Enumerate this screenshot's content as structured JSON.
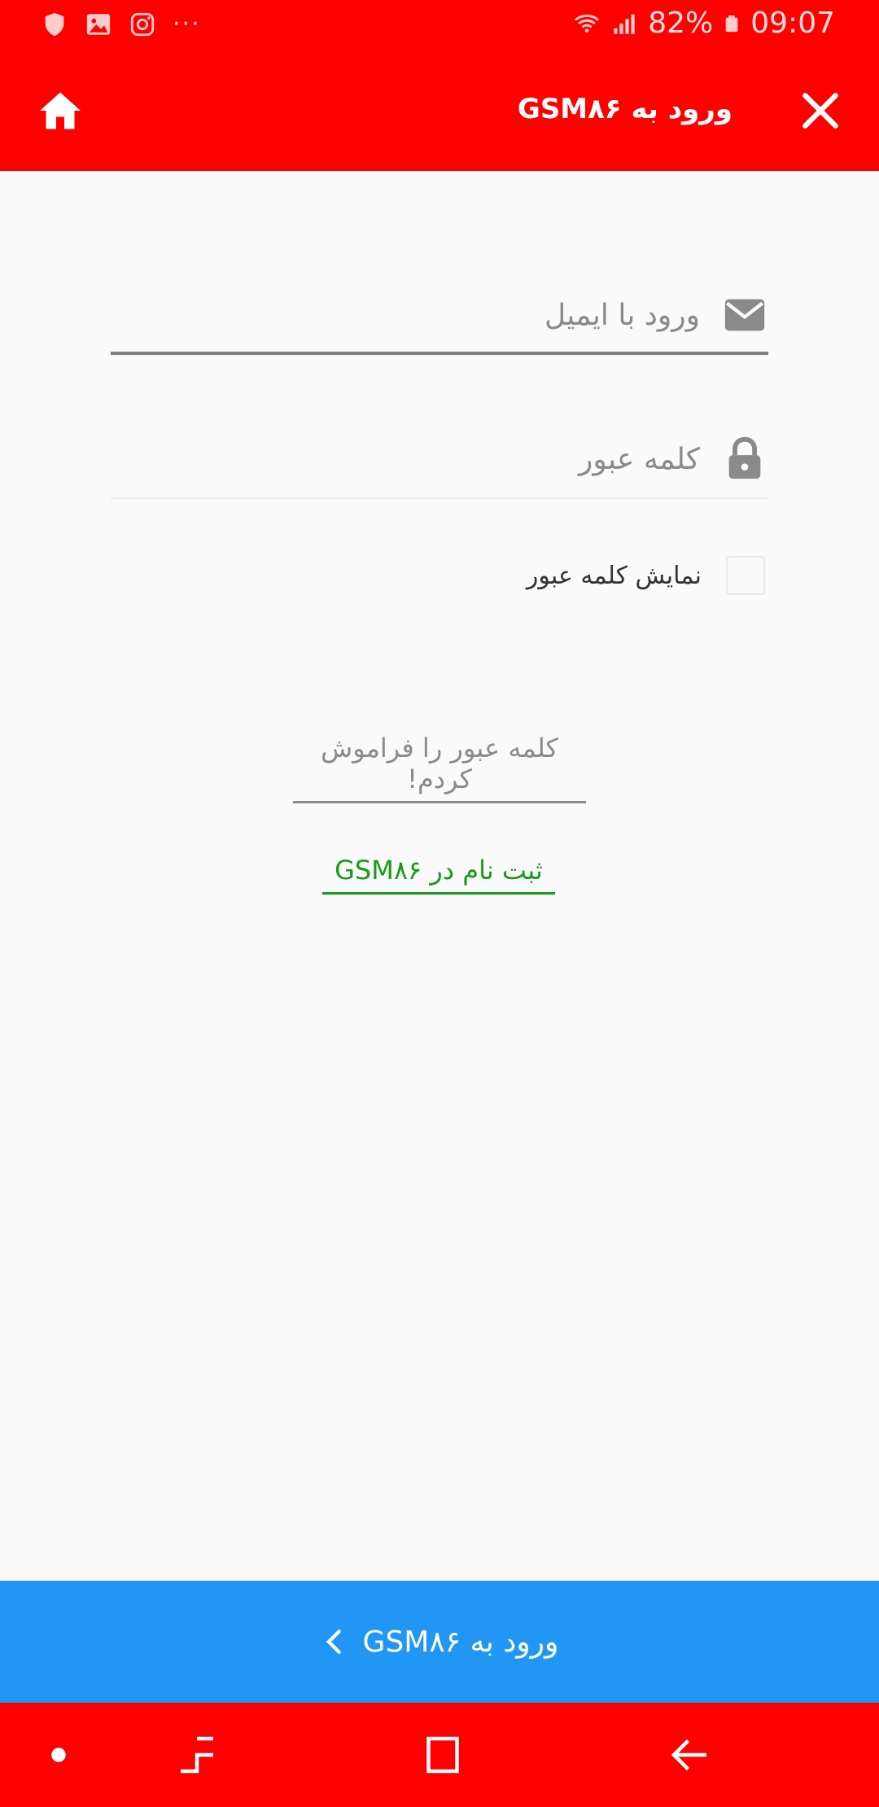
{
  "status_bar": {
    "battery": "82%",
    "time": "09:07",
    "overflow": "···"
  },
  "app_bar": {
    "title": "ورود به GSM۸۶"
  },
  "form": {
    "email_placeholder": "ورود با ایمیل",
    "password_placeholder": "کلمه عبور",
    "show_password_label": "نمایش کلمه عبور",
    "forgot_password_link": "کلمه عبور را فراموش کردم!",
    "register_link": "ثبت نام در GSM۸۶"
  },
  "login_button": {
    "label": "ورود به GSM۸۶"
  },
  "colors": {
    "primary": "#ff0000",
    "button": "#2196f3",
    "link_green": "#1a9a1a"
  }
}
